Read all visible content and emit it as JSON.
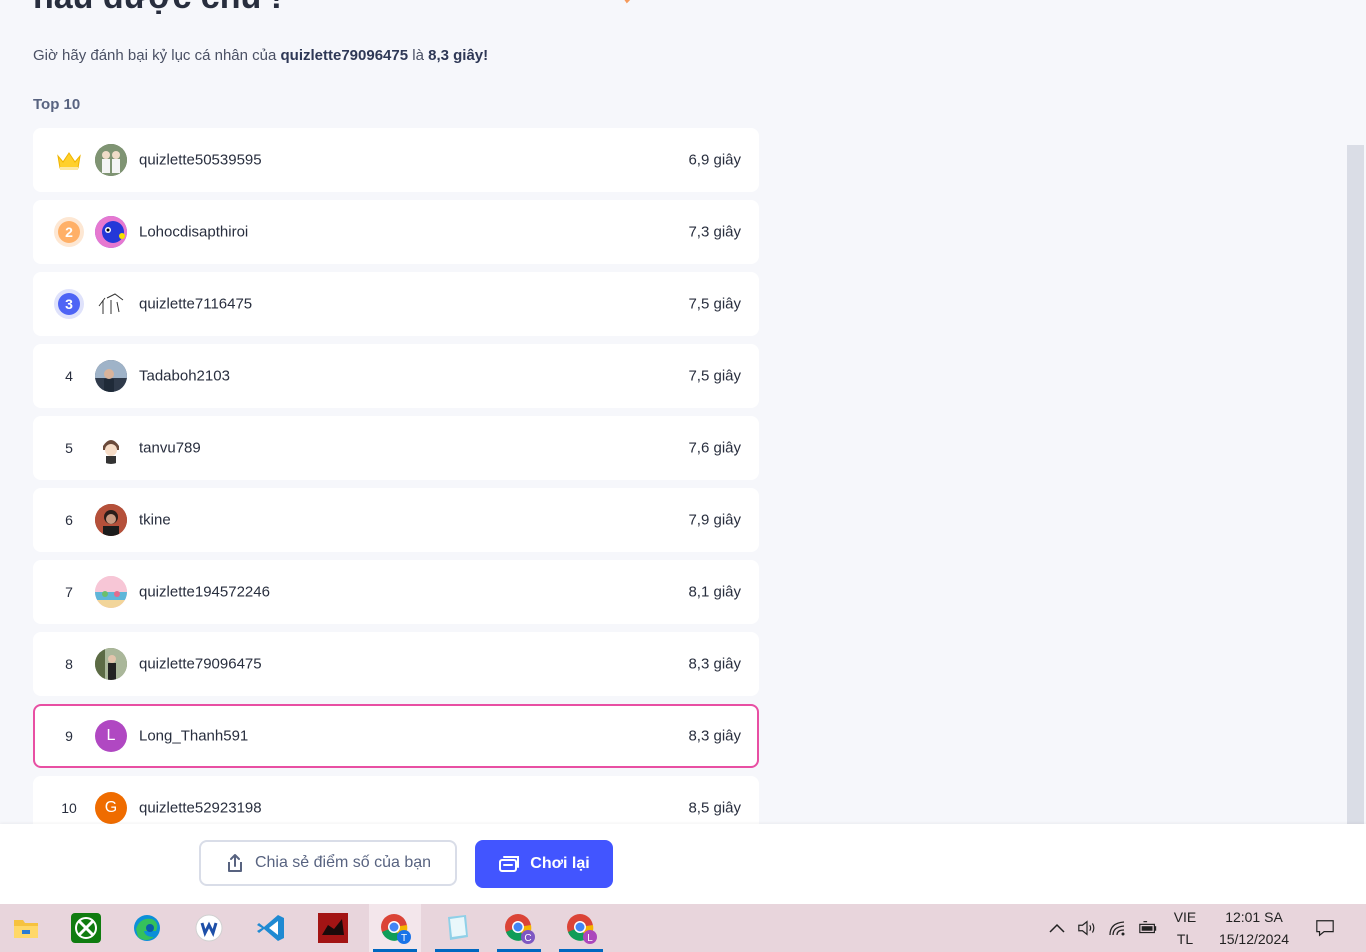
{
  "page": {
    "heading": "hầu được chủ !",
    "subtitle_prefix": "Giờ hãy đánh bại kỷ lục cá nhân của",
    "subtitle_user": "quizlette79096475",
    "subtitle_mid": "là",
    "subtitle_time": "8,3 giây!",
    "section_label": "Top 10"
  },
  "leaderboard": [
    {
      "rank": "1",
      "name": "quizlette50539595",
      "score": "6,9 giây",
      "avatar": "photo-two-people"
    },
    {
      "rank": "2",
      "name": "Lohocdisapthiroi",
      "score": "7,3 giây",
      "avatar": "cartoon-blue"
    },
    {
      "rank": "3",
      "name": "quizlette7116475",
      "score": "7,5 giây",
      "avatar": "sketch"
    },
    {
      "rank": "4",
      "name": "Tadaboh2103",
      "score": "7,5 giây",
      "avatar": "photo-person"
    },
    {
      "rank": "5",
      "name": "tanvu789",
      "score": "7,6 giây",
      "avatar": "anime-character"
    },
    {
      "rank": "6",
      "name": "tkine",
      "score": "7,9 giây",
      "avatar": "photo-portrait"
    },
    {
      "rank": "7",
      "name": "quizlette194572246",
      "score": "8,1 giây",
      "avatar": "illustration-beach"
    },
    {
      "rank": "8",
      "name": "quizlette79096475",
      "score": "8,3 giây",
      "avatar": "photo-outdoor"
    },
    {
      "rank": "9",
      "name": "Long_Thanh591",
      "score": "8,3 giây",
      "avatar_letter": "L",
      "avatar_color": "#b048c2",
      "highlight": true
    },
    {
      "rank": "10",
      "name": "quizlette52923198",
      "score": "8,5 giây",
      "avatar_letter": "G",
      "avatar_color": "#ef6c00"
    }
  ],
  "footer": {
    "share_label": "Chia sẻ điểm số của bạn",
    "replay_label": "Chơi lại"
  },
  "taskbar": {
    "apps": [
      "file-explorer",
      "xbox",
      "edge",
      "word-app",
      "vscode",
      "game-app",
      "chrome-T",
      "notepad",
      "chrome-C",
      "chrome-L"
    ],
    "chrome_badges": [
      "T",
      "C",
      "L"
    ],
    "lang_top": "VIE",
    "lang_bottom": "TL",
    "time": "12:01 SA",
    "date": "15/12/2024"
  },
  "colors": {
    "accent": "#4255ff",
    "highlight_border": "#e84fa3",
    "silver_medal": "#ffb067",
    "bronze_medal": "#4e64f5"
  }
}
